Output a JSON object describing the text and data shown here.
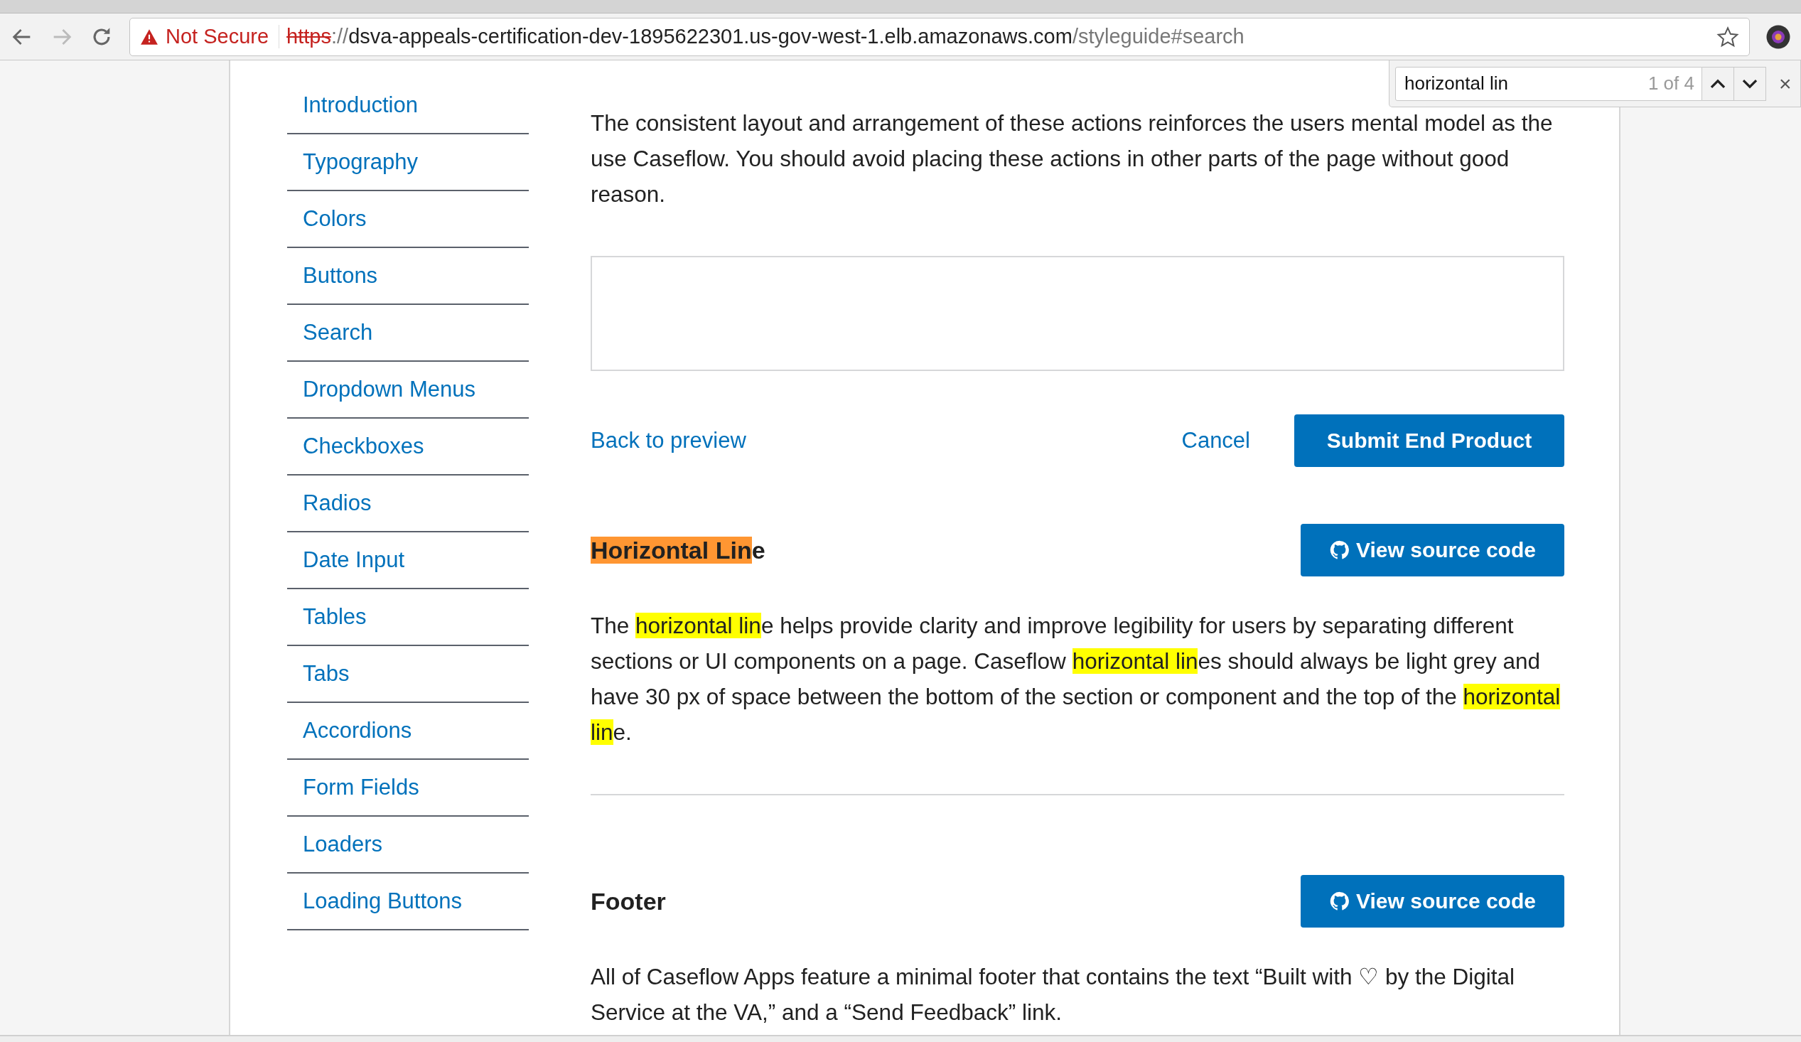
{
  "address_bar": {
    "warning": "Not Secure",
    "scheme": "https",
    "separator": "://",
    "host": "dsva-appeals-certification-dev-1895622301.us-gov-west-1.elb.amazonaws.com",
    "path": "/styleguide#search"
  },
  "find_bar": {
    "value": "horizontal lin",
    "count": "1 of 4",
    "close": "×"
  },
  "sidebar": {
    "items": [
      {
        "label": "Introduction"
      },
      {
        "label": "Typography"
      },
      {
        "label": "Colors"
      },
      {
        "label": "Buttons"
      },
      {
        "label": "Search"
      },
      {
        "label": "Dropdown Menus"
      },
      {
        "label": "Checkboxes"
      },
      {
        "label": "Radios"
      },
      {
        "label": "Date Input"
      },
      {
        "label": "Tables"
      },
      {
        "label": "Tabs"
      },
      {
        "label": "Accordions"
      },
      {
        "label": "Form Fields"
      },
      {
        "label": "Loaders"
      },
      {
        "label": "Loading Buttons"
      }
    ]
  },
  "intro": [
    "The consistent layout and arrangement of these actions reinforces the users mental model as the use Caseflow. You should avoid placing these actions in other parts of the page without good reason."
  ],
  "form_actions": {
    "back": "Back to preview",
    "cancel": "Cancel",
    "submit": "Submit End Product"
  },
  "sections": [
    {
      "heading": [
        {
          "text": "Horizontal Lin",
          "highlighted": true,
          "current": true
        },
        {
          "text": "e",
          "highlighted": false
        }
      ],
      "button": "View source code",
      "body": [
        {
          "text": "The ",
          "highlighted": false
        },
        {
          "text": "horizontal lin",
          "highlighted": true,
          "current": false
        },
        {
          "text": "e helps provide clarity and improve legibility for users by separating different sections or UI components on a page. Caseflow ",
          "highlighted": false
        },
        {
          "text": "horizontal lin",
          "highlighted": true,
          "current": false
        },
        {
          "text": "es should always be light grey and have 30 px of space between the bottom of the section or component and the top of the ",
          "highlighted": false
        },
        {
          "text": "horizontal lin",
          "highlighted": true,
          "current": false
        },
        {
          "text": "e.",
          "highlighted": false
        }
      ],
      "rule": true
    },
    {
      "heading": [
        {
          "text": "Footer",
          "highlighted": false
        }
      ],
      "button": "View source code",
      "body": [
        {
          "text": "All of Caseflow Apps feature a minimal footer that contains the text “Built with ♡ by the Digital Service at the VA,” and a “Send Feedback” link.",
          "highlighted": false
        }
      ],
      "rule": false
    }
  ]
}
